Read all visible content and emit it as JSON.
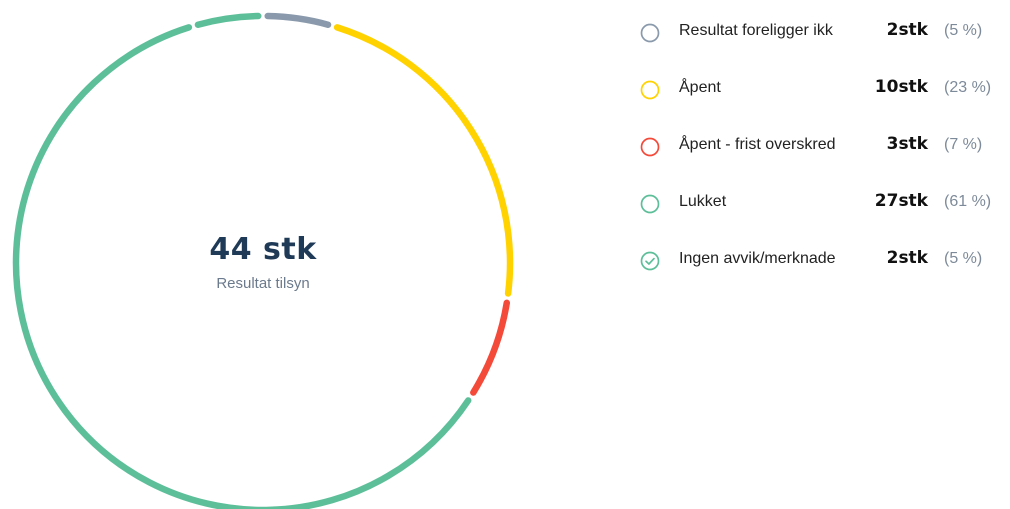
{
  "chart_data": {
    "type": "donut",
    "total": {
      "value": "44 stk",
      "label": "Resultat tilsyn"
    },
    "series": [
      {
        "name": "Resultat foreligger ikk",
        "count": 2,
        "count_label": "2stk",
        "percent": 5,
        "percent_label": "(5 %)",
        "color": "#8a9aac",
        "marker": "circle-outline"
      },
      {
        "name": "Åpent",
        "count": 10,
        "count_label": "10stk",
        "percent": 23,
        "percent_label": "(23 %)",
        "color": "#ffd200",
        "marker": "circle-outline"
      },
      {
        "name": "Åpent - frist overskred",
        "count": 3,
        "count_label": "3stk",
        "percent": 7,
        "percent_label": "(7 %)",
        "color": "#f44a3a",
        "marker": "circle-outline"
      },
      {
        "name": "Lukket",
        "count": 27,
        "count_label": "27stk",
        "percent": 61,
        "percent_label": "(61 %)",
        "color": "#5dbf9a",
        "marker": "circle-outline"
      },
      {
        "name": "Ingen avvik/merknade",
        "count": 2,
        "count_label": "2stk",
        "percent": 5,
        "percent_label": "(5 %)",
        "color": "#5dbf9a",
        "marker": "circle-check"
      }
    ]
  }
}
